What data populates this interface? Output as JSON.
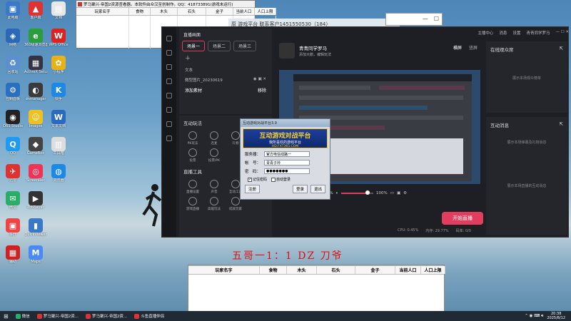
{
  "desktop": {
    "icons": [
      {
        "label": "此电脑",
        "color": "#3a78c8",
        "glyph": "▣"
      },
      {
        "label": "客户端",
        "color": "#d33",
        "glyph": "▲"
      },
      {
        "label": "文档",
        "color": "#e8e8e8",
        "glyph": "▤"
      },
      {
        "label": "网络",
        "color": "#2b68b8",
        "glyph": "◈"
      },
      {
        "label": "360极速浏览器",
        "color": "#2a9d3c",
        "glyph": "e"
      },
      {
        "label": "WPS Office",
        "color": "#d22",
        "glyph": "W"
      },
      {
        "label": "回收站",
        "color": "#5b8fd0",
        "glyph": "♻"
      },
      {
        "label": "ActiveX Setup",
        "color": "#334",
        "glyph": "▦"
      },
      {
        "label": "小程序",
        "color": "#e6b21c",
        "glyph": "✿"
      },
      {
        "label": "控制面板",
        "color": "#2a70c0",
        "glyph": "⚙"
      },
      {
        "label": "dnmanager",
        "color": "#3a3a3a",
        "glyph": "◐"
      },
      {
        "label": "快手",
        "color": "#1e88e5",
        "glyph": "K"
      },
      {
        "label": "OBS Studio",
        "color": "#222",
        "glyph": "◉"
      },
      {
        "label": "Images",
        "color": "#f0c020",
        "glyph": "☺"
      },
      {
        "label": "文本文档",
        "color": "#2a6ac0",
        "glyph": "W"
      },
      {
        "label": "QQ",
        "color": "#1d9bf0",
        "glyph": "Q"
      },
      {
        "label": "GameBox",
        "color": "#444",
        "glyph": "◆"
      },
      {
        "label": "工具箱",
        "color": "#ddd",
        "glyph": "▥"
      },
      {
        "label": "迅雷",
        "color": "#d33",
        "glyph": "✈"
      },
      {
        "label": "ScreenRec",
        "color": "#e35",
        "glyph": "◎"
      },
      {
        "label": "浏览器",
        "color": "#1e88e5",
        "glyph": "◍"
      },
      {
        "label": "微信",
        "color": "#2aae67",
        "glyph": "✉"
      },
      {
        "label": "PotPlayer",
        "color": "#333",
        "glyph": "▶"
      },
      {
        "label": "",
        "color": "transparent",
        "glyph": ""
      },
      {
        "label": "多开",
        "color": "#e44",
        "glyph": "▣"
      },
      {
        "label": "QuickViewer",
        "color": "#3a78c8",
        "glyph": "▮"
      },
      {
        "label": "",
        "color": "transparent",
        "glyph": ""
      },
      {
        "label": "辅助",
        "color": "#c22",
        "glyph": "▦"
      },
      {
        "label": "Maps",
        "color": "#4a8af4",
        "glyph": "M"
      }
    ]
  },
  "tool_window": {
    "title": "罗马聚兴-帝国2资源查看器。本软件由众汉至创制作。QQ：418733891(游戏未运行)",
    "columns": [
      "玩家名字",
      "食物",
      "木头",
      "石头",
      "金子",
      "当前人口",
      "人口上限"
    ]
  },
  "back_window": {
    "title": "原 游戏平台 联系客户1451550530（184）"
  },
  "app": {
    "scenes_title": "直播画面",
    "scene_tabs": [
      "场景一",
      "场景二",
      "场景三"
    ],
    "sources_title": "文本",
    "source_item": "微型图片_20230619",
    "add_source": "添加素材",
    "add_source_action": "移除",
    "tools_title": "互动玩法",
    "tools": [
      "PK玩法",
      "连麦",
      "礼物",
      "互动游戏",
      "投票",
      "投票/PK",
      "",
      ""
    ],
    "tools2_title": "直播工具",
    "tools2": [
      "直播设置",
      "声音",
      "互动工具",
      "房管",
      "游戏直播",
      "高能玩法",
      "成就玩家",
      ""
    ],
    "streamer_name": "青青同学罗马",
    "streamer_sub": "添加大鹅，编辑玩法",
    "orient": [
      "横屏",
      "竖屏"
    ],
    "topbar": [
      "主播中心",
      "消息",
      "设置",
      "青青同学罗马"
    ],
    "volume1": "100%",
    "volume2": "100%",
    "start_label": "开始直播",
    "status": [
      "CPU: 0.45%",
      "内存: 29.77%",
      "码率: 0/0"
    ],
    "right_title1": "在线观众席",
    "right_empty1": "展示本场观众榜单",
    "right_title2": "互动消息",
    "right_empty2": "展示本场弹幕及礼物消息",
    "right_empty3": "展示本场直播的互动消息"
  },
  "dialog": {
    "title": "互动游戏对战平台3.9",
    "banner_main": "互动游戏对战平台",
    "banner_sub": "我所喜欢的游戏平台",
    "banner_url": "HD.FXT365.COM",
    "server_label": "服务器：",
    "server_value": "官方电信线路一",
    "account_label": "帐　号：",
    "account_value": "青青子衿",
    "password_label": "密　码：",
    "password_value": "●●●●●●●",
    "remember": "记住密码",
    "auto_login": "自动登录",
    "register": "注册",
    "login": "登录",
    "exit": "退出"
  },
  "overlay_text": "五哥一1：1 DZ 刀爷",
  "bottom_table": {
    "columns": [
      "玩家名字",
      "食物",
      "木头",
      "石头",
      "金子",
      "当前人口",
      "人口上限"
    ]
  },
  "taskbar": {
    "tasks": [
      "微信",
      "罗马聚兴-帝国2资...",
      "罗马聚兴-帝国2资...",
      "斗鱼直播伴侣"
    ],
    "time": "20:38",
    "date": "2025/8/12"
  }
}
